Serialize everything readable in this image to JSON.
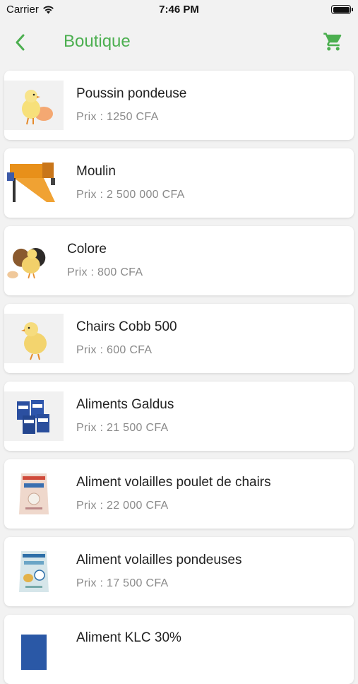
{
  "status": {
    "carrier": "Carrier",
    "time": "7:46 PM"
  },
  "header": {
    "title": "Boutique"
  },
  "accent_color": "#4caf50",
  "products": [
    {
      "name": "Poussin pondeuse",
      "price": "Prix : 1250 CFA",
      "image": "chick-with-egg"
    },
    {
      "name": "Moulin",
      "price": "Prix : 2 500 000 CFA",
      "image": "orange-mill-machine"
    },
    {
      "name": "Colore",
      "price": "Prix : 800 CFA",
      "image": "colored-chicks"
    },
    {
      "name": "Chairs Cobb 500",
      "price": "Prix : 600 CFA",
      "image": "yellow-chick"
    },
    {
      "name": "Aliments Galdus",
      "price": "Prix : 21 500 CFA",
      "image": "blue-feed-bags"
    },
    {
      "name": "Aliment volailles poulet de chairs",
      "price": "Prix : 22 000 CFA",
      "image": "feed-sack-pink"
    },
    {
      "name": "Aliment volailles pondeuses",
      "price": "Prix : 17 500 CFA",
      "image": "feed-sack-blue"
    },
    {
      "name": "Aliment KLC 30%",
      "price": "",
      "image": "feed-bag-blue"
    }
  ]
}
